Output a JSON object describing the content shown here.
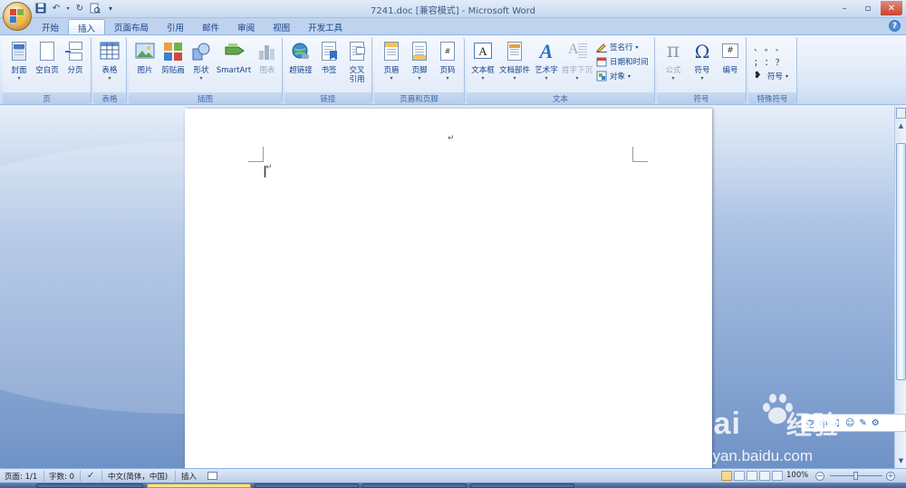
{
  "app": {
    "window_title": "7241.doc [兼容模式] - Microsoft Word"
  },
  "qat": {
    "items": [
      "save-icon",
      "undo-icon",
      "redo-icon",
      "print-preview-icon",
      "customize-icon"
    ]
  },
  "tabs": [
    {
      "label": "开始",
      "active": false
    },
    {
      "label": "插入",
      "active": true
    },
    {
      "label": "页面布局",
      "active": false
    },
    {
      "label": "引用",
      "active": false
    },
    {
      "label": "邮件",
      "active": false
    },
    {
      "label": "审阅",
      "active": false
    },
    {
      "label": "视图",
      "active": false
    },
    {
      "label": "开发工具",
      "active": false
    }
  ],
  "ribbon": {
    "pages": {
      "label": "页",
      "cover": "封面",
      "blank": "空白页",
      "break": "分页"
    },
    "tables": {
      "label": "表格",
      "table": "表格"
    },
    "illustrations": {
      "label": "插图",
      "picture": "图片",
      "clipart": "剪贴画",
      "shapes": "形状",
      "smartart": "SmartArt",
      "chart": "图表"
    },
    "links": {
      "label": "链接",
      "hyperlink": "超链接",
      "bookmark": "书签",
      "crossref_1": "交叉",
      "crossref_2": "引用"
    },
    "header_footer": {
      "label": "页眉和页脚",
      "header": "页眉",
      "footer": "页脚",
      "page_number": "页码"
    },
    "text": {
      "label": "文本",
      "textbox": "文本框",
      "quickparts": "文档部件",
      "wordart": "艺术字",
      "dropcap": "首字下沉",
      "signature": "签名行",
      "datetime": "日期和时间",
      "object": "对象"
    },
    "symbols": {
      "label": "符号",
      "equation": "公式",
      "symbol": "符号",
      "numbering": "编号"
    },
    "special": {
      "label": "特殊符号",
      "chars_row1": "、 。 、",
      "chars_row2": "； ： ？",
      "symbol": "符号"
    }
  },
  "document": {
    "paragraph_mark": "↵"
  },
  "ime": {
    "items": [
      "空",
      "中",
      "♫",
      "☺",
      "✎",
      "⚙"
    ]
  },
  "watermark": {
    "brand": "Bai",
    "brand_2": "经验",
    "url": "jingyan.baidu.com"
  },
  "status": {
    "page": "页面: 1/1",
    "words": "字数: 0",
    "language": "中文(简体，中国)",
    "mode": "插入",
    "zoom": "100%"
  },
  "colors": {
    "accent": "#15428b",
    "ribbon_top": "#f1f6fd",
    "doc_bg": "#a9c1e3"
  }
}
